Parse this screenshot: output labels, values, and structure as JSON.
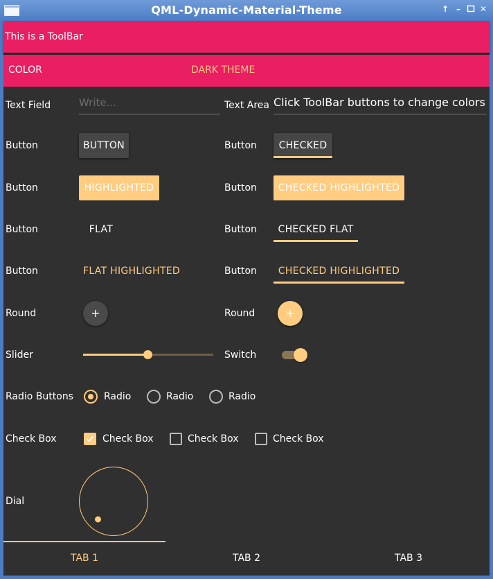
{
  "window": {
    "title": "QML-Dynamic-Material-Theme"
  },
  "toolbar_top": {
    "label": "This is a ToolBar"
  },
  "toolbar_buttons": {
    "color": "COLOR",
    "dark_theme": "DARK THEME"
  },
  "labels": {
    "text_field": "Text Field",
    "text_area": "Text Area",
    "button": "Button",
    "round": "Round",
    "slider": "Slider",
    "switch": "Switch",
    "radio_buttons": "Radio Buttons",
    "check_box": "Check Box",
    "dial": "Dial"
  },
  "text_field": {
    "placeholder": "Write..."
  },
  "text_area": {
    "value": "Click ToolBar buttons to change colors"
  },
  "buttons": {
    "button": "BUTTON",
    "checked": "CHECKED",
    "highlighted": "HIGHLIGHTED",
    "checked_highlighted": "CHECKED HIGHLIGHTED",
    "flat": "FLAT",
    "checked_flat": "CHECKED FLAT",
    "flat_highlighted": "FLAT HIGHLIGHTED",
    "checked_highlighted_flat": "CHECKED HIGHLIGHTED"
  },
  "round": {
    "symbol": "+"
  },
  "slider": {
    "value": 0.5
  },
  "switch": {
    "checked": true
  },
  "radios": {
    "items": [
      "Radio",
      "Radio",
      "Radio"
    ],
    "selected_index": 0
  },
  "checkboxes": {
    "items": [
      "Check Box",
      "Check Box",
      "Check Box"
    ],
    "checked": [
      true,
      false,
      false
    ]
  },
  "dial": {
    "value": 0.1
  },
  "tabs": {
    "items": [
      "TAB 1",
      "TAB 2",
      "TAB 3"
    ],
    "active_index": 0
  },
  "colors": {
    "accent": "#ffcc80",
    "primary": "#e91e63",
    "background": "#303030",
    "titlebar": "#4c7cc4"
  }
}
